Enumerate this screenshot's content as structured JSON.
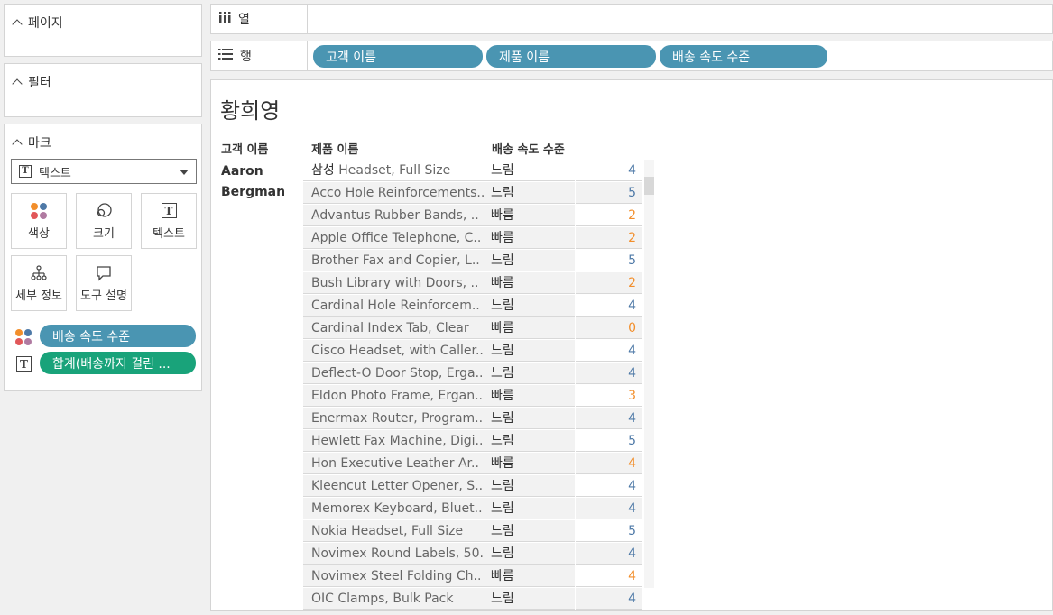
{
  "left_panel": {
    "pages": {
      "title": "페이지"
    },
    "filters": {
      "title": "필터"
    },
    "marks": {
      "title": "마크",
      "mark_type": "텍스트",
      "buttons": {
        "color": "색상",
        "size": "크기",
        "text": "텍스트",
        "detail": "세부 정보",
        "tooltip": "도구 설명"
      },
      "pills": {
        "color_pill": "배송 속도 수준",
        "text_pill": "합계(배송까지 걸린 ..."
      }
    }
  },
  "shelves": {
    "columns": {
      "label": "열",
      "pills": []
    },
    "rows": {
      "label": "행",
      "pills": [
        "고객 이름",
        "제품 이름",
        "배송 속도 수준"
      ]
    }
  },
  "view": {
    "title": "황희영",
    "headers": {
      "customer": "고객 이름",
      "product": "제품 이름",
      "speed": "배송 속도 수준"
    },
    "customer_line1": "Aaron",
    "customer_line2": "Bergman",
    "rows": [
      {
        "product_prefix": "삼성 ",
        "product": "Headset, Full Size",
        "speed": "느림",
        "value": "4"
      },
      {
        "product_prefix": "",
        "product": "Acco Hole Reinforcements..",
        "speed": "느림",
        "value": "5"
      },
      {
        "product_prefix": "",
        "product": "Advantus Rubber Bands, ..",
        "speed": "빠름",
        "value": "2"
      },
      {
        "product_prefix": "",
        "product": "Apple Office Telephone, C..",
        "speed": "빠름",
        "value": "2"
      },
      {
        "product_prefix": "",
        "product": "Brother Fax and Copier, L..",
        "speed": "느림",
        "value": "5"
      },
      {
        "product_prefix": "",
        "product": "Bush Library with Doors, ..",
        "speed": "빠름",
        "value": "2"
      },
      {
        "product_prefix": "",
        "product": "Cardinal Hole Reinforcem..",
        "speed": "느림",
        "value": "4"
      },
      {
        "product_prefix": "",
        "product": "Cardinal Index Tab, Clear",
        "speed": "빠름",
        "value": "0"
      },
      {
        "product_prefix": "",
        "product": "Cisco Headset, with Caller..",
        "speed": "느림",
        "value": "4"
      },
      {
        "product_prefix": "",
        "product": "Deflect-O Door Stop, Erga..",
        "speed": "느림",
        "value": "4"
      },
      {
        "product_prefix": "",
        "product": "Eldon Photo Frame, Ergan..",
        "speed": "빠름",
        "value": "3"
      },
      {
        "product_prefix": "",
        "product": "Enermax Router, Program..",
        "speed": "느림",
        "value": "4"
      },
      {
        "product_prefix": "",
        "product": "Hewlett Fax Machine, Digi..",
        "speed": "느림",
        "value": "5"
      },
      {
        "product_prefix": "",
        "product": "Hon Executive Leather Ar..",
        "speed": "빠름",
        "value": "4"
      },
      {
        "product_prefix": "",
        "product": "Kleencut Letter Opener, S..",
        "speed": "느림",
        "value": "4"
      },
      {
        "product_prefix": "",
        "product": "Memorex Keyboard, Bluet..",
        "speed": "느림",
        "value": "4"
      },
      {
        "product_prefix": "",
        "product": "Nokia Headset, Full Size",
        "speed": "느림",
        "value": "5"
      },
      {
        "product_prefix": "",
        "product": "Novimex Round Labels, 50..",
        "speed": "느림",
        "value": "4"
      },
      {
        "product_prefix": "",
        "product": "Novimex Steel Folding Ch..",
        "speed": "빠름",
        "value": "4"
      },
      {
        "product_prefix": "",
        "product": "OIC Clamps, Bulk Pack",
        "speed": "느림",
        "value": "4"
      }
    ]
  },
  "colors": {
    "slow": "#4e79a7",
    "fast": "#f28e2b",
    "pill_blue": "#4a95b2",
    "pill_green": "#19a37a"
  }
}
